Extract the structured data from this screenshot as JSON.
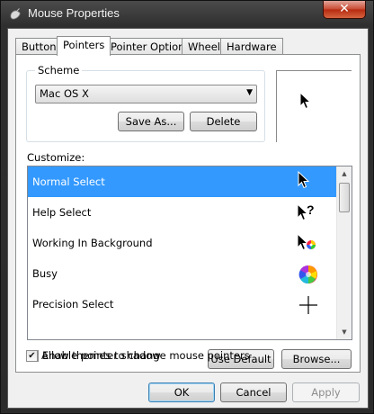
{
  "window": {
    "title": "Mouse Properties",
    "close_label": "✕"
  },
  "tabs": [
    {
      "label": "Buttons"
    },
    {
      "label": "Pointers"
    },
    {
      "label": "Pointer Options"
    },
    {
      "label": "Wheel"
    },
    {
      "label": "Hardware"
    }
  ],
  "active_tab": "Pointers",
  "scheme": {
    "label": "Scheme",
    "selected": "Mac OS X",
    "save_as_label": "Save As...",
    "delete_label": "Delete"
  },
  "customize": {
    "label": "Customize:",
    "items": [
      {
        "label": "Normal Select",
        "icon": "arrow-cursor-icon"
      },
      {
        "label": "Help Select",
        "icon": "help-cursor-icon"
      },
      {
        "label": "Working In Background",
        "icon": "working-cursor-icon"
      },
      {
        "label": "Busy",
        "icon": "busy-wheel-icon"
      },
      {
        "label": "Precision Select",
        "icon": "crosshair-icon"
      }
    ],
    "selected_item": "Normal Select"
  },
  "options": {
    "pointer_shadow_label": "Enable pointer shadow",
    "pointer_shadow_checked": true,
    "themes_label": "Allow themes to change mouse pointers",
    "themes_checked": true,
    "use_default_label": "Use Default",
    "browse_label": "Browse..."
  },
  "footer": {
    "ok_label": "OK",
    "cancel_label": "Cancel",
    "apply_label": "Apply"
  },
  "colors": {
    "selection": "#3399ff",
    "close_button": "#c9482f"
  }
}
